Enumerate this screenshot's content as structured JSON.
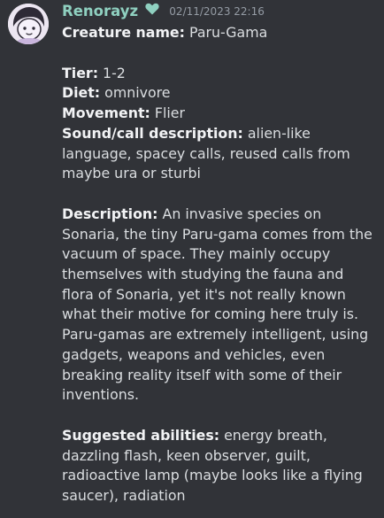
{
  "message": {
    "username": "Renorayz",
    "timestamp": "02/11/2023 22:16",
    "icons": {
      "avatar": "avatar-cartoon-face",
      "badge": "heart-icon"
    },
    "colors": {
      "username": "#8fd0c0",
      "heart": "#8fd0c0",
      "background": "#313338"
    },
    "fields": {
      "creature_name": {
        "label": "Creature name:",
        "value": "Paru-Gama"
      },
      "tier": {
        "label": "Tier:",
        "value": "1-2"
      },
      "diet": {
        "label": "Diet:",
        "value": "omnivore"
      },
      "movement": {
        "label": "Movement:",
        "value": "Flier"
      },
      "sound": {
        "label": "Sound/call description:",
        "value": "alien-like language, spacey calls, reused calls from maybe ura or sturbi"
      },
      "description": {
        "label": "Description:",
        "value": "An invasive species on Sonaria, the tiny Paru-gama comes from the vacuum of space. They mainly occupy themselves with studying the fauna and flora of Sonaria, yet it's not really known what their motive for coming here truly is. Paru-gamas are extremely intelligent, using gadgets, weapons and vehicles, even breaking reality itself with some of their inventions."
      },
      "abilities": {
        "label": "Suggested abilities:",
        "value": "energy breath, dazzling flash, keen observer, guilt, radioactive lamp (maybe looks like a flying saucer), radiation"
      }
    }
  }
}
